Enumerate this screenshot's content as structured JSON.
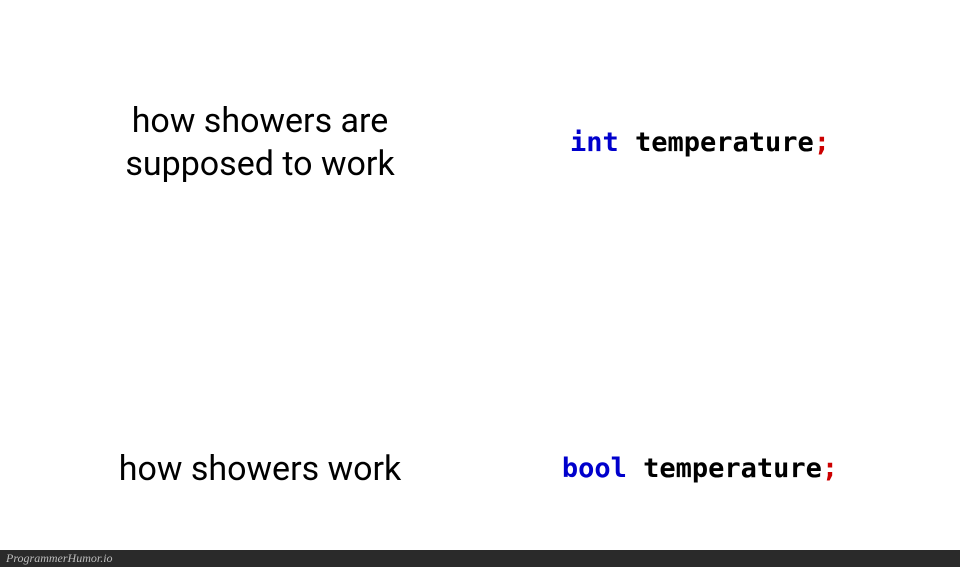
{
  "rows": [
    {
      "caption": "how showers are supposed to work",
      "code": {
        "keyword": "int",
        "identifier": "temperature",
        "semicolon": ";"
      }
    },
    {
      "caption": "how showers work",
      "code": {
        "keyword": "bool",
        "identifier": "temperature",
        "semicolon": ";"
      }
    }
  ],
  "footer": "ProgrammerHumor.io"
}
